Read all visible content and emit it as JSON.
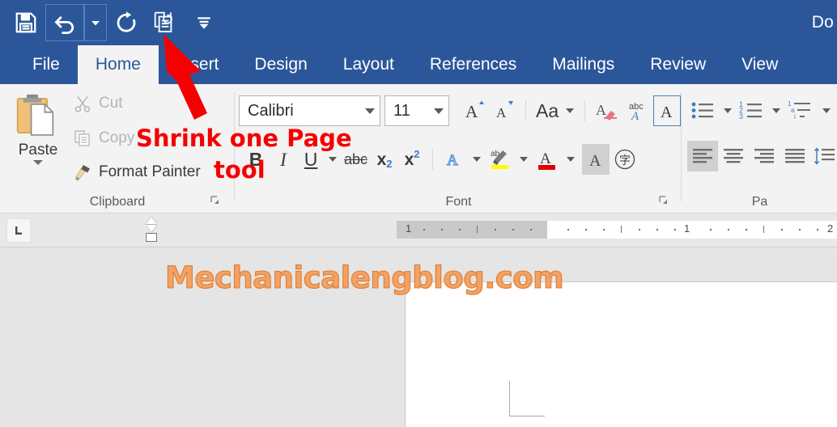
{
  "window": {
    "title": "Do"
  },
  "quick_access": {
    "items": [
      {
        "name": "save-icon",
        "tooltip": "Save"
      },
      {
        "name": "undo-icon",
        "tooltip": "Undo"
      },
      {
        "name": "undo-dropdown-icon",
        "tooltip": "Undo options"
      },
      {
        "name": "redo-icon",
        "tooltip": "Repeat"
      },
      {
        "name": "shrink-one-page-icon",
        "tooltip": "Shrink One Page"
      },
      {
        "name": "customize-quick-access-toolbar-icon",
        "tooltip": "Customize Quick Access Toolbar"
      }
    ]
  },
  "ribbon": {
    "tabs": [
      {
        "label": "File",
        "active": false
      },
      {
        "label": "Home",
        "active": true
      },
      {
        "label": "Insert",
        "active": false
      },
      {
        "label": "Design",
        "active": false
      },
      {
        "label": "Layout",
        "active": false
      },
      {
        "label": "References",
        "active": false
      },
      {
        "label": "Mailings",
        "active": false
      },
      {
        "label": "Review",
        "active": false
      },
      {
        "label": "View",
        "active": false
      }
    ],
    "groups": {
      "clipboard": {
        "label": "Clipboard",
        "paste_label": "Paste",
        "cut_label": "Cut",
        "copy_label": "Copy",
        "format_painter_label": "Format Painter"
      },
      "font": {
        "label": "Font",
        "font_name": "Calibri",
        "font_size": "11",
        "change_case_label": "Aa",
        "bold_label": "B",
        "italic_label": "I",
        "underline_label": "U",
        "strikethrough_label": "abc",
        "subscript_label": "x",
        "subscript_sub": "2",
        "superscript_label": "x",
        "superscript_sup": "2",
        "text_highlight_label": "ab",
        "font_color_label": "A",
        "character_shading_label": "A",
        "character_border_label": "字",
        "grow_font_label": "A",
        "shrink_font_label": "A",
        "clear_formatting_label": "A",
        "text_effects_label": "A"
      },
      "paragraph": {
        "label": "Pa"
      }
    }
  },
  "ruler": {
    "tab_stop_selector": "left-tab",
    "ticks": [
      {
        "label": "1",
        "pos": 8
      },
      {
        "label": "1",
        "pos": 352
      },
      {
        "label": "2",
        "pos": 529
      }
    ]
  },
  "document": {
    "watermark": "Mechanicalengblog.com"
  },
  "annotation": {
    "line1": "Shrink one Page",
    "line2": "tool",
    "color": "#f50000"
  },
  "colors": {
    "ribbon_blue": "#2b579a",
    "ribbon_bg": "#f3f3f3",
    "canvas_gray": "#e5e5e5",
    "watermark_orange": "#f2a265",
    "annotation_red": "#f50000"
  }
}
